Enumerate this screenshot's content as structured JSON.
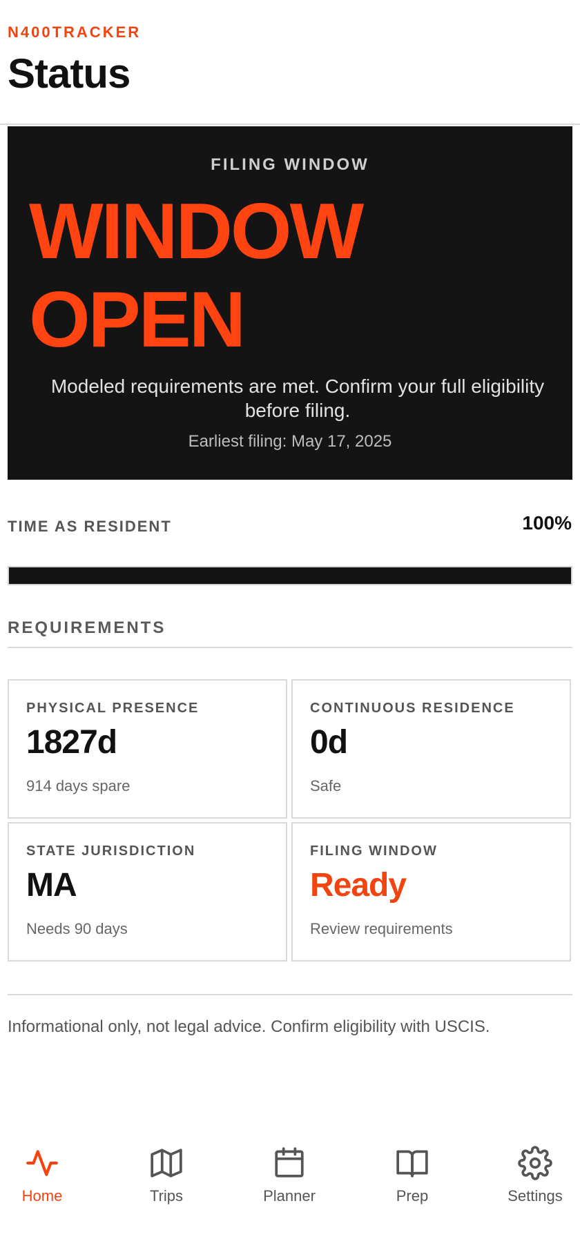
{
  "header": {
    "brand": "N400TRACKER",
    "title": "Status"
  },
  "hero": {
    "eyebrow": "FILING WINDOW",
    "status_line1": "WINDOW",
    "status_line2": "OPEN",
    "description": "Modeled requirements are met. Confirm your full eligibility before filing.",
    "earliest_filing": "Earliest filing: May 17, 2025"
  },
  "progress": {
    "label": "TIME AS RESIDENT",
    "value_text": "100%",
    "fraction": 1.0
  },
  "requirements": {
    "title": "REQUIREMENTS",
    "cards": [
      {
        "label": "PHYSICAL PRESENCE",
        "value": "1827d",
        "sub": "914 days spare"
      },
      {
        "label": "CONTINUOUS RESIDENCE",
        "value": "0d",
        "sub": "Safe"
      },
      {
        "label": "STATE JURISDICTION",
        "value": "MA",
        "sub": "Needs 90 days"
      },
      {
        "label": "FILING WINDOW",
        "value": "Ready",
        "sub": "Review requirements"
      }
    ]
  },
  "disclaimer": "Informational only, not legal advice. Confirm eligibility with USCIS.",
  "tabbar": {
    "items": [
      {
        "label": "Home",
        "icon": "activity-icon",
        "active": true
      },
      {
        "label": "Trips",
        "icon": "map-icon",
        "active": false
      },
      {
        "label": "Planner",
        "icon": "calendar-icon",
        "active": false
      },
      {
        "label": "Prep",
        "icon": "book-icon",
        "active": false
      },
      {
        "label": "Settings",
        "icon": "gear-icon",
        "active": false
      }
    ]
  },
  "colors": {
    "accent": "#f24411",
    "hero_background": "#141414"
  }
}
